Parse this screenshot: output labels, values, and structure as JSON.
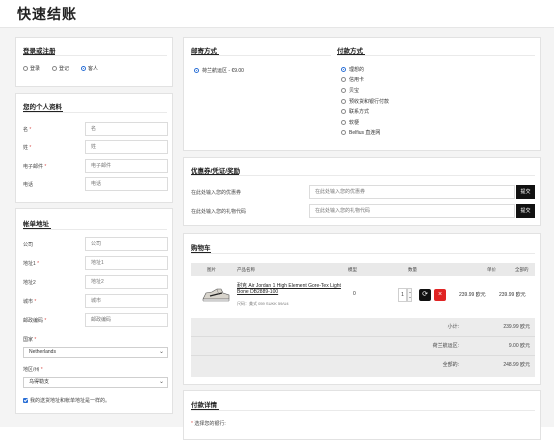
{
  "page": {
    "title": "快速结账"
  },
  "login": {
    "title": "登录或注册",
    "options": [
      {
        "label": "登录",
        "selected": false
      },
      {
        "label": "登记",
        "selected": false
      },
      {
        "label": "客人",
        "selected": true
      }
    ]
  },
  "personal": {
    "title": "您的个人资料",
    "fields": [
      {
        "label": "名",
        "required": true,
        "placeholder": "名"
      },
      {
        "label": "姓",
        "required": true,
        "placeholder": "姓"
      },
      {
        "label": "电子邮件",
        "required": true,
        "placeholder": "电子邮件"
      },
      {
        "label": "电话",
        "required": false,
        "placeholder": "电话"
      }
    ]
  },
  "billing": {
    "title": "帐单地址",
    "fields": [
      {
        "label": "公司",
        "required": false,
        "placeholder": "公司"
      },
      {
        "label": "地址1",
        "required": true,
        "placeholder": "地址1"
      },
      {
        "label": "地址2",
        "required": false,
        "placeholder": "地址2"
      },
      {
        "label": "城市",
        "required": true,
        "placeholder": "城市"
      },
      {
        "label": "邮政编码",
        "required": true,
        "placeholder": "邮政编码"
      }
    ],
    "country_label": "国家",
    "country_value": "Netherlands",
    "region_label": "地区/州",
    "region_value": "乌得勒支",
    "same_address_label": "我的送货地址和帐单地址是一样的。"
  },
  "shipping": {
    "title": "邮寄方式",
    "options": [
      {
        "label": "荷兰航运区 - €9.00",
        "selected": true
      }
    ]
  },
  "payment": {
    "title": "付款方式",
    "options": [
      {
        "label": "理想的",
        "selected": true
      },
      {
        "label": "信用卡",
        "selected": false
      },
      {
        "label": "贝宝",
        "selected": false
      },
      {
        "label": "预收货和银行付款",
        "selected": false
      },
      {
        "label": "联系方式",
        "selected": false
      },
      {
        "label": "软梗",
        "selected": false
      },
      {
        "label": "Belfius 直连网",
        "selected": false
      }
    ]
  },
  "coupon": {
    "title": "优惠券/凭证/奖励",
    "rows": [
      {
        "label": "在此处输入您的优惠券",
        "placeholder": "在此处输入您的优惠券",
        "button": "提交"
      },
      {
        "label": "在此处输入您的礼物代码",
        "placeholder": "在此处输入您的礼物代码",
        "button": "提交"
      }
    ]
  },
  "cart": {
    "title": "购物车",
    "headers": [
      "图片",
      "产品名称",
      "模型",
      "数量",
      "单价",
      "全部的"
    ],
    "items": [
      {
        "name": "耐克 Air Jordan 1 High Element Gore-Tex Light Bone DB2889-100",
        "options": "尺码：美式 059 SUKK 59/U4",
        "model": "0",
        "qty": "1",
        "unit": "239.99 欧元",
        "total": "239.99 欧元"
      }
    ],
    "totals": [
      {
        "label": "小计:",
        "value": "239.99 欧元"
      },
      {
        "label": "荷兰航运区:",
        "value": "9.00 欧元"
      },
      {
        "label": "全部的:",
        "value": "248.99 欧元"
      }
    ]
  },
  "payment_details": {
    "title": "付款详情",
    "bank_label": "选择您的银行:"
  },
  "colors": {
    "accent": "#2a6fd6",
    "danger": "#e02424",
    "dark": "#111111",
    "required": "#d9534f"
  }
}
